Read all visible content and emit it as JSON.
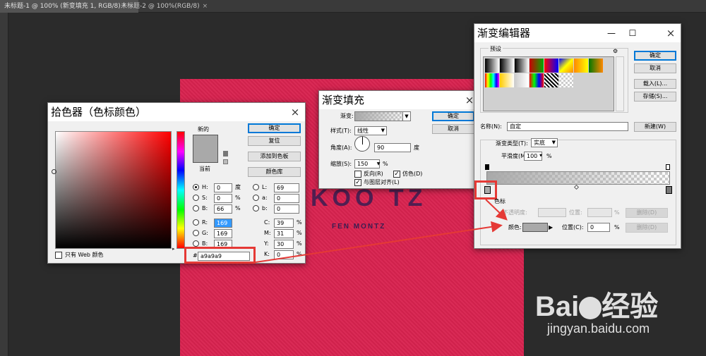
{
  "tabs": [
    {
      "label": "未标题-1 @ 100% (新变填充 1, RGB/8) *",
      "close": "×"
    },
    {
      "label": "未标题-2 @ 100%(RGB/8)",
      "close": "×"
    }
  ],
  "canvas_text": {
    "line1": "KOO TZ",
    "line2": "FEN MONTZ"
  },
  "color_picker": {
    "title": "拾色器（色标颜色）",
    "close": "×",
    "new_label": "新的",
    "current_label": "当前",
    "ok": "确定",
    "reset": "复位",
    "add_swatch": "添加到色板",
    "color_library": "颜色库",
    "only_web": "只有 Web 颜色",
    "hex_label": "#",
    "hex_value": "a9a9a9",
    "swatch_color": "#a9a9a9",
    "fields_left": [
      {
        "key": "H:",
        "value": "0",
        "unit": "度"
      },
      {
        "key": "S:",
        "value": "0",
        "unit": "%"
      },
      {
        "key": "B:",
        "value": "66",
        "unit": "%"
      },
      {
        "key": "R:",
        "value": "169",
        "unit": ""
      },
      {
        "key": "G:",
        "value": "169",
        "unit": ""
      },
      {
        "key": "B:",
        "value": "169",
        "unit": ""
      }
    ],
    "fields_right": [
      {
        "key": "L:",
        "value": "69",
        "unit": ""
      },
      {
        "key": "a:",
        "value": "0",
        "unit": ""
      },
      {
        "key": "b:",
        "value": "0",
        "unit": ""
      },
      {
        "key": "C:",
        "value": "39",
        "unit": "%"
      },
      {
        "key": "M:",
        "value": "31",
        "unit": "%"
      },
      {
        "key": "Y:",
        "value": "30",
        "unit": "%"
      },
      {
        "key": "K:",
        "value": "0",
        "unit": "%"
      }
    ]
  },
  "gradient_fill": {
    "title": "渐变填充",
    "close": "×",
    "gradient_label": "渐变:",
    "style_label": "样式(T):",
    "style_value": "线性",
    "angle_label": "角度(A):",
    "angle_value": "90",
    "angle_unit": "度",
    "scale_label": "缩放(S):",
    "scale_value": "150",
    "scale_unit": "%",
    "reverse": "反向(R)",
    "dither": "仿色(D)",
    "align": "与图层对齐(L)",
    "ok": "确定",
    "cancel": "取消"
  },
  "gradient_editor": {
    "title": "渐变编辑器",
    "presets_label": "预设",
    "gear": "⚙",
    "ok": "确定",
    "cancel": "取消",
    "load": "载入(L)...",
    "save": "存储(S)...",
    "name_label": "名称(N):",
    "name_value": "自定",
    "new": "新建(W)",
    "type_label": "渐变类型(T):",
    "type_value": "实底",
    "smooth_label": "平滑度(M):",
    "smooth_value": "100",
    "smooth_unit": "%",
    "stops_label": "色标",
    "opacity_label": "不透明度:",
    "position_label": "位置:",
    "delete": "删除(D)",
    "color_label": "颜色:",
    "position_c_label": "位置(C):",
    "position_c_value": "0",
    "percent": "%",
    "minimize": "—",
    "maximize": "☐",
    "close": "×"
  },
  "watermark": {
    "brand": "Bai",
    "brand2": "经验",
    "url": "jingyan.baidu.com"
  }
}
